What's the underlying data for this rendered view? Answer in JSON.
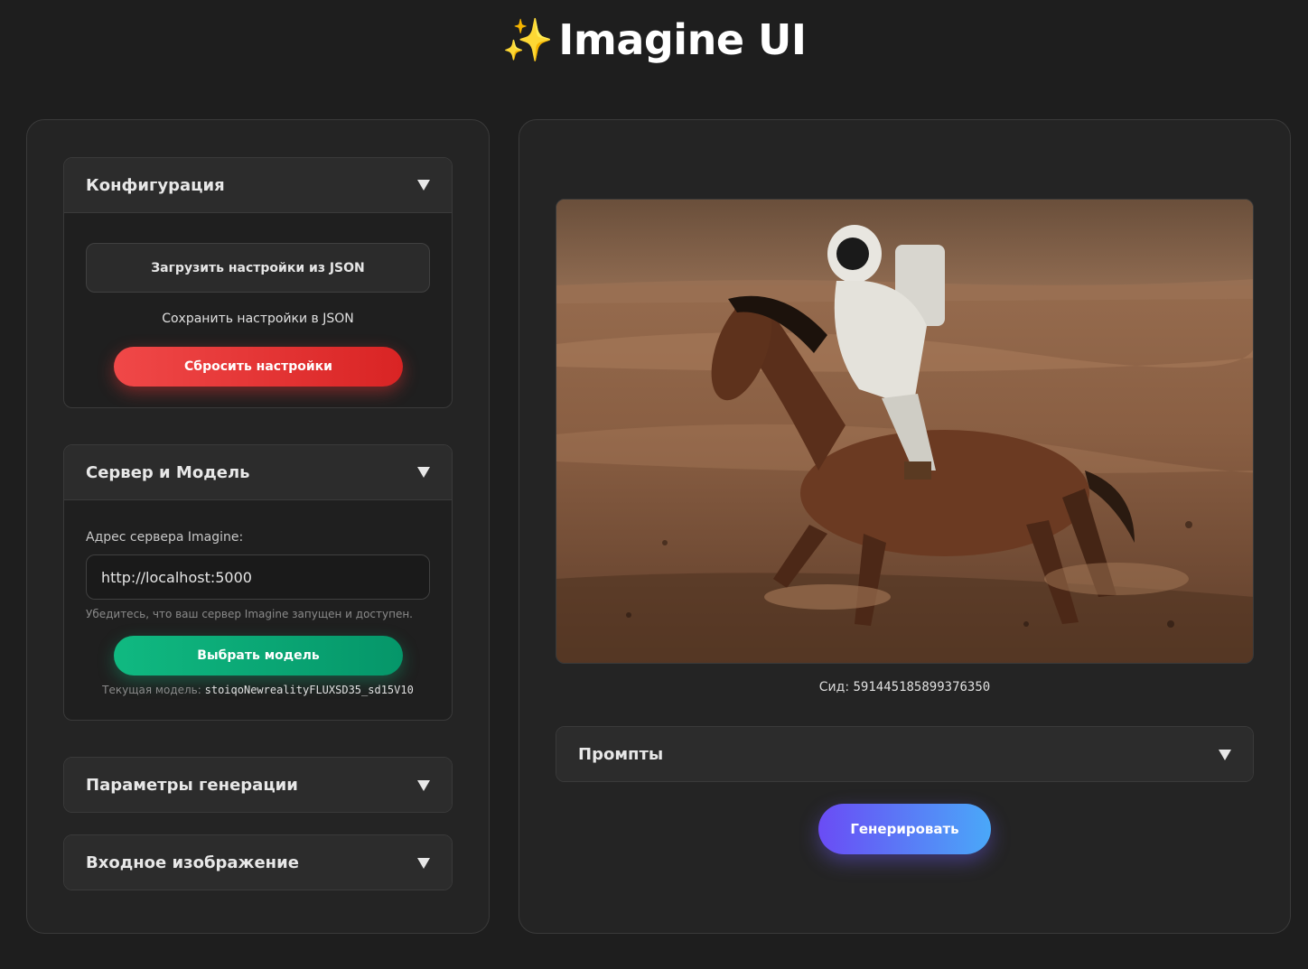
{
  "app": {
    "title": "Imagine UI",
    "title_icon": "sparkles-icon",
    "title_emoji": "✨"
  },
  "colors": {
    "background": "#1e1e1e",
    "panel": "#242424",
    "danger": "#e53535",
    "success": "#10b981",
    "generate_gradient_start": "#6a4cf5",
    "generate_gradient_end": "#4aa8f8"
  },
  "config": {
    "title": "Конфигурация",
    "load_label": "Загрузить настройки из JSON",
    "save_label": "Сохранить настройки в JSON",
    "reset_label": "Сбросить настройки"
  },
  "server": {
    "title": "Сервер и Модель",
    "address_label": "Адрес сервера Imagine:",
    "address_value": "http://localhost:5000",
    "hint": "Убедитесь, что ваш сервер Imagine запущен и доступен.",
    "select_model_label": "Выбрать модель",
    "current_model_label": "Текущая модель:",
    "current_model_value": "stoiqoNewrealityFLUXSD35_sd15V10"
  },
  "generation": {
    "title": "Параметры генерации"
  },
  "input_image": {
    "title": "Входное изображение"
  },
  "result": {
    "seed_label": "Сид:",
    "seed_value": "591445185899376350"
  },
  "prompts": {
    "title": "Промпты"
  },
  "generate_label": "Генерировать"
}
